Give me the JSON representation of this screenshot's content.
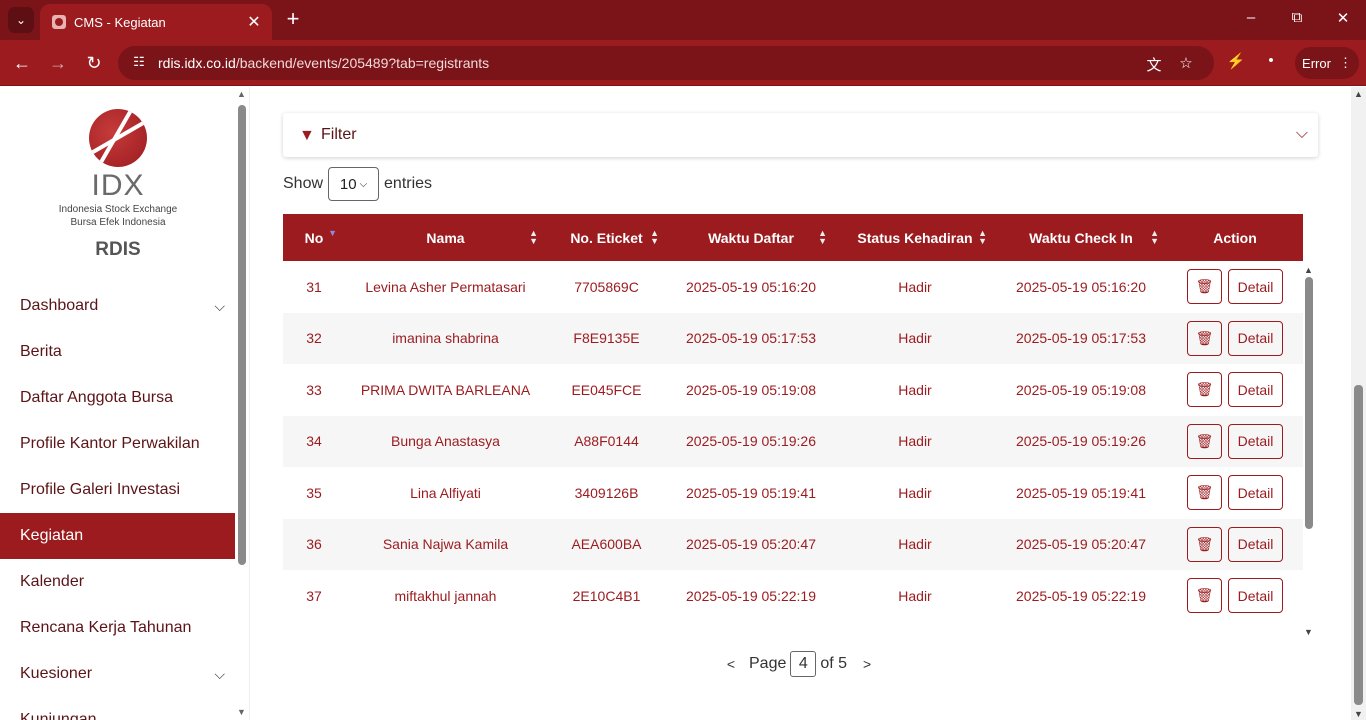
{
  "browser": {
    "tab_title": "CMS - Kegiatan",
    "url_host": "rdis.idx.co.id",
    "url_path": "/backend/events/205489?tab=registrants",
    "profile_label": "Error"
  },
  "sidebar": {
    "logo_text": "IDX",
    "logo_sub1": "Indonesia Stock Exchange",
    "logo_sub2": "Bursa Efek Indonesia",
    "app_name": "RDIS",
    "items": [
      {
        "label": "Dashboard",
        "has_children": true
      },
      {
        "label": "Berita"
      },
      {
        "label": "Daftar Anggota Bursa"
      },
      {
        "label": "Profile Kantor Perwakilan"
      },
      {
        "label": "Profile Galeri Investasi"
      },
      {
        "label": "Kegiatan",
        "active": true
      },
      {
        "label": "Kalender"
      },
      {
        "label": "Rencana Kerja Tahunan"
      },
      {
        "label": "Kuesioner",
        "has_children": true
      },
      {
        "label": "Kunjungan"
      }
    ]
  },
  "filter": {
    "label": "Filter"
  },
  "length": {
    "show": "Show",
    "value": "10",
    "entries": "entries"
  },
  "table": {
    "headers": [
      "No",
      "Nama",
      "No. Eticket",
      "Waktu Daftar",
      "Status Kehadiran",
      "Waktu Check In",
      "Action"
    ],
    "rows": [
      {
        "no": "31",
        "nama": "Levina Asher Permatasari",
        "eticket": "7705869C",
        "daftar": "2025-05-19 05:16:20",
        "status": "Hadir",
        "checkin": "2025-05-19 05:16:20"
      },
      {
        "no": "32",
        "nama": "imanina shabrina",
        "eticket": "F8E9135E",
        "daftar": "2025-05-19 05:17:53",
        "status": "Hadir",
        "checkin": "2025-05-19 05:17:53"
      },
      {
        "no": "33",
        "nama": "PRIMA DWITA BARLEANA",
        "eticket": "EE045FCE",
        "daftar": "2025-05-19 05:19:08",
        "status": "Hadir",
        "checkin": "2025-05-19 05:19:08"
      },
      {
        "no": "34",
        "nama": "Bunga Anastasya",
        "eticket": "A88F0144",
        "daftar": "2025-05-19 05:19:26",
        "status": "Hadir",
        "checkin": "2025-05-19 05:19:26"
      },
      {
        "no": "35",
        "nama": "Lina Alfiyati",
        "eticket": "3409126B",
        "daftar": "2025-05-19 05:19:41",
        "status": "Hadir",
        "checkin": "2025-05-19 05:19:41"
      },
      {
        "no": "36",
        "nama": "Sania Najwa Kamila",
        "eticket": "AEA600BA",
        "daftar": "2025-05-19 05:20:47",
        "status": "Hadir",
        "checkin": "2025-05-19 05:20:47"
      },
      {
        "no": "37",
        "nama": "miftakhul jannah",
        "eticket": "2E10C4B1",
        "daftar": "2025-05-19 05:22:19",
        "status": "Hadir",
        "checkin": "2025-05-19 05:22:19"
      }
    ],
    "detail_label": "Detail"
  },
  "pagination": {
    "prev": "<",
    "page_label": "Page",
    "current": "4",
    "of_label": "of 5",
    "next": ">"
  },
  "colors": {
    "brand": "#9b1b1f",
    "brand_dark": "#7a1419"
  }
}
